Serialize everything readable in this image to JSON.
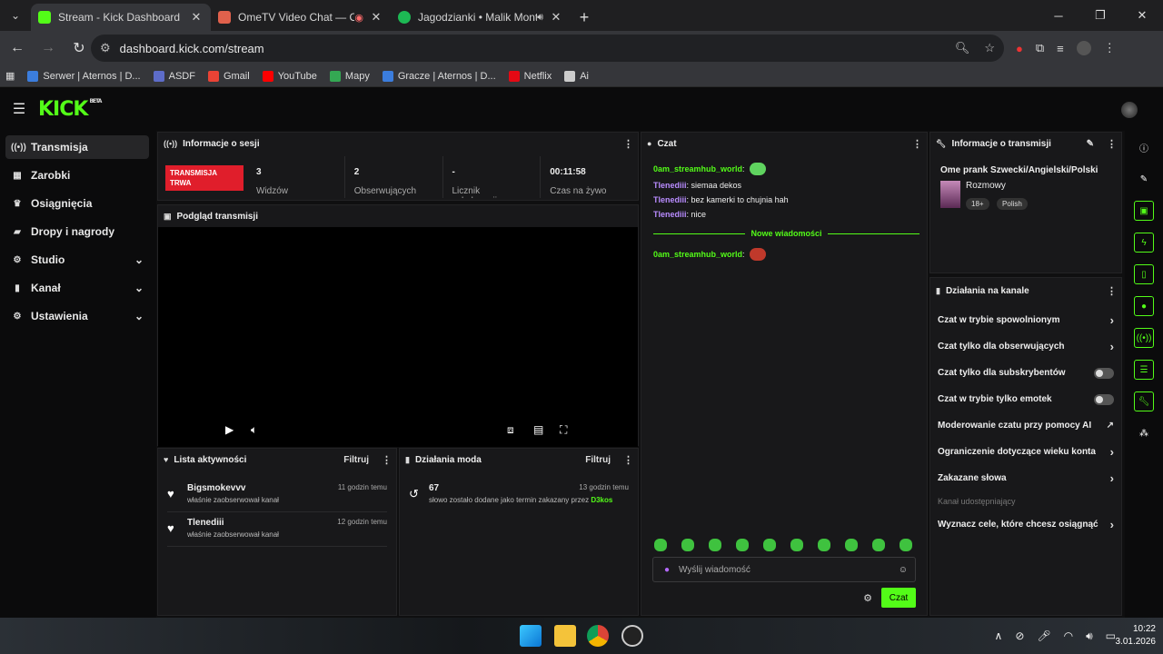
{
  "browser": {
    "tabs": [
      {
        "title": "Stream - Kick Dashboard",
        "favicon_color": "#53fc18",
        "active": true
      },
      {
        "title": "OmeTV Video Chat — Ome",
        "favicon_color": "#e0614c",
        "active": false
      },
      {
        "title": "Jagodzianki • Malik Montana",
        "favicon_color": "#1db954",
        "active": false
      }
    ],
    "url": "dashboard.kick.com/stream",
    "bookmarks": [
      {
        "label": "Serwer | Aternos | D...",
        "color": "#3b7ddd"
      },
      {
        "label": "ASDF",
        "color": "#5d6cc9"
      },
      {
        "label": "Gmail",
        "color": "#ea4335"
      },
      {
        "label": "YouTube",
        "color": "#ff0000"
      },
      {
        "label": "Mapy",
        "color": "#34a853"
      },
      {
        "label": "Gracze | Aternos | D...",
        "color": "#3b7ddd"
      },
      {
        "label": "Netflix",
        "color": "#e50914"
      },
      {
        "label": "Ai",
        "color": "#cccccc"
      }
    ]
  },
  "kick": {
    "logo": "KICK",
    "beta": "BETA",
    "sidebar": [
      {
        "label": "Transmisja",
        "icon": "broadcast-icon"
      },
      {
        "label": "Zarobki",
        "icon": "earnings-icon"
      },
      {
        "label": "Osiągnięcia",
        "icon": "trophy-icon"
      },
      {
        "label": "Dropy i nagrody",
        "icon": "gift-icon"
      },
      {
        "label": "Studio",
        "icon": "studio-icon"
      },
      {
        "label": "Kanał",
        "icon": "channel-icon"
      },
      {
        "label": "Ustawienia",
        "icon": "settings-icon"
      }
    ]
  },
  "session": {
    "title": "Informacje o sesji",
    "live_badge": "TRANSMISJA TRWA",
    "stats": [
      {
        "value": "3",
        "label": "Widzów"
      },
      {
        "value": "2",
        "label": "Obserwujących"
      },
      {
        "value": "-",
        "label": "Licznik subskrypcji"
      },
      {
        "value": "00:11:58",
        "label": "Czas na żywo"
      }
    ]
  },
  "preview": {
    "title": "Podgląd transmisji"
  },
  "activity": {
    "title": "Lista aktywności",
    "filter": "Filtruj",
    "items": [
      {
        "name": "Bigsmokevvv",
        "sub": "właśnie zaobserwował kanał",
        "time": "11 godzin temu"
      },
      {
        "name": "Tlenediii",
        "sub": "właśnie zaobserwował kanał",
        "time": "12 godzin temu"
      }
    ]
  },
  "mod": {
    "title": "Działania moda",
    "filter": "Filtruj",
    "items": [
      {
        "name": "67",
        "sub": "słowo zostało dodane jako termin zakazany przez",
        "by": "D3kos",
        "time": "13 godzin temu"
      }
    ]
  },
  "chat": {
    "title": "Czat",
    "messages": [
      {
        "user": "0am_streamhub_world",
        "color": "#53fc18",
        "text": ""
      },
      {
        "user": "Tlenediii",
        "color": "#b98cff",
        "text": "siemaa dekos"
      },
      {
        "user": "Tlenediii",
        "color": "#b98cff",
        "text": "bez kamerki to chujnia hah"
      },
      {
        "user": "Tlenediii",
        "color": "#b98cff",
        "text": "nice"
      }
    ],
    "new_messages": "Nowe wiadomości",
    "after": [
      {
        "user": "0am_streamhub_world",
        "color": "#53fc18",
        "text": ""
      }
    ],
    "placeholder": "Wyślij wiadomość",
    "send": "Czat"
  },
  "stream_info": {
    "title": "Informacje o transmisji",
    "stream_title": "Ome prank Szwecki/Angielski/Polski",
    "category": "Rozmowy",
    "tags": [
      "18+",
      "Polish"
    ]
  },
  "channel_actions": {
    "title": "Działania na kanale",
    "rows": [
      {
        "label": "Czat w trybie spowolnionym",
        "control": "chevron"
      },
      {
        "label": "Czat tylko dla obserwujących",
        "control": "chevron"
      },
      {
        "label": "Czat tylko dla subskrybentów",
        "control": "toggle"
      },
      {
        "label": "Czat w trybie tylko emotek",
        "control": "toggle"
      },
      {
        "label": "Moderowanie czatu przy pomocy AI",
        "control": "external"
      },
      {
        "label": "Ograniczenie dotyczące wieku konta",
        "control": "chevron"
      },
      {
        "label": "Zakazane słowa",
        "control": "chevron"
      }
    ],
    "shared_label": "Kanał udostępniający",
    "goals": "Wyznacz cele, które chcesz osiągnąć"
  },
  "taskbar": {
    "time": "10:22",
    "date": "3.01.2026"
  }
}
